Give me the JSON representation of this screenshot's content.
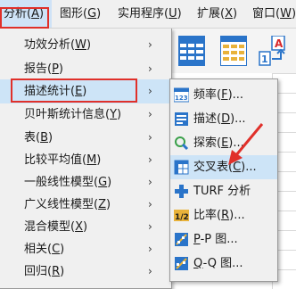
{
  "menubar": {
    "items": [
      {
        "label": "分析(",
        "key": "A",
        "tail": ")",
        "active": true
      },
      {
        "label": "图形(",
        "key": "G",
        "tail": ")"
      },
      {
        "label": "实用程序(",
        "key": "U",
        "tail": ")"
      },
      {
        "label": "扩展(",
        "key": "X",
        "tail": ")"
      },
      {
        "label": "窗口(",
        "key": "W",
        "tail": ")"
      }
    ]
  },
  "analyze_menu": {
    "items": [
      {
        "label": "功效分析(",
        "key": "W",
        "tail": ")"
      },
      {
        "label": "报告(",
        "key": "P",
        "tail": ")"
      },
      {
        "label": "描述统计(",
        "key": "E",
        "tail": ")"
      },
      {
        "label": "贝叶斯统计信息(",
        "key": "Y",
        "tail": ")"
      },
      {
        "label": "表(",
        "key": "B",
        "tail": ")"
      },
      {
        "label": "比较平均值(",
        "key": "M",
        "tail": ")"
      },
      {
        "label": "一般线性模型(",
        "key": "G",
        "tail": ")"
      },
      {
        "label": "广义线性模型(",
        "key": "Z",
        "tail": ")"
      },
      {
        "label": "混合模型(",
        "key": "X",
        "tail": ")"
      },
      {
        "label": "相关(",
        "key": "C",
        "tail": ")"
      },
      {
        "label": "回归(",
        "key": "R",
        "tail": ")"
      }
    ],
    "arrow": "›"
  },
  "descriptive_menu": {
    "items": [
      {
        "label": "频率(",
        "key": "F",
        "tail": ")...",
        "icon": "frequencies-icon"
      },
      {
        "label": "描述(",
        "key": "D",
        "tail": ")...",
        "icon": "descriptives-icon"
      },
      {
        "label": "探索(",
        "key": "E",
        "tail": ")...",
        "icon": "explore-icon"
      },
      {
        "label": "交叉表(",
        "key": "C",
        "tail": ")...",
        "icon": "crosstabs-icon"
      },
      {
        "label": "TURF 分析",
        "key": "",
        "tail": "",
        "icon": "turf-icon"
      },
      {
        "label": "比率(",
        "key": "R",
        "tail": ")...",
        "icon": "ratio-icon"
      },
      {
        "label": "",
        "key": "P",
        "tail": "-P 图...",
        "icon": "pp-plot-icon"
      },
      {
        "label": "",
        "key": "Q",
        "tail": "-Q 图...",
        "icon": "qq-plot-icon"
      }
    ]
  },
  "icons": {
    "ratio_text": "1/2",
    "freq_text": "123"
  },
  "colors": {
    "highlight_box": "#e0302a",
    "menu_highlight": "#cde4f7",
    "arrow": "#e0302a"
  }
}
